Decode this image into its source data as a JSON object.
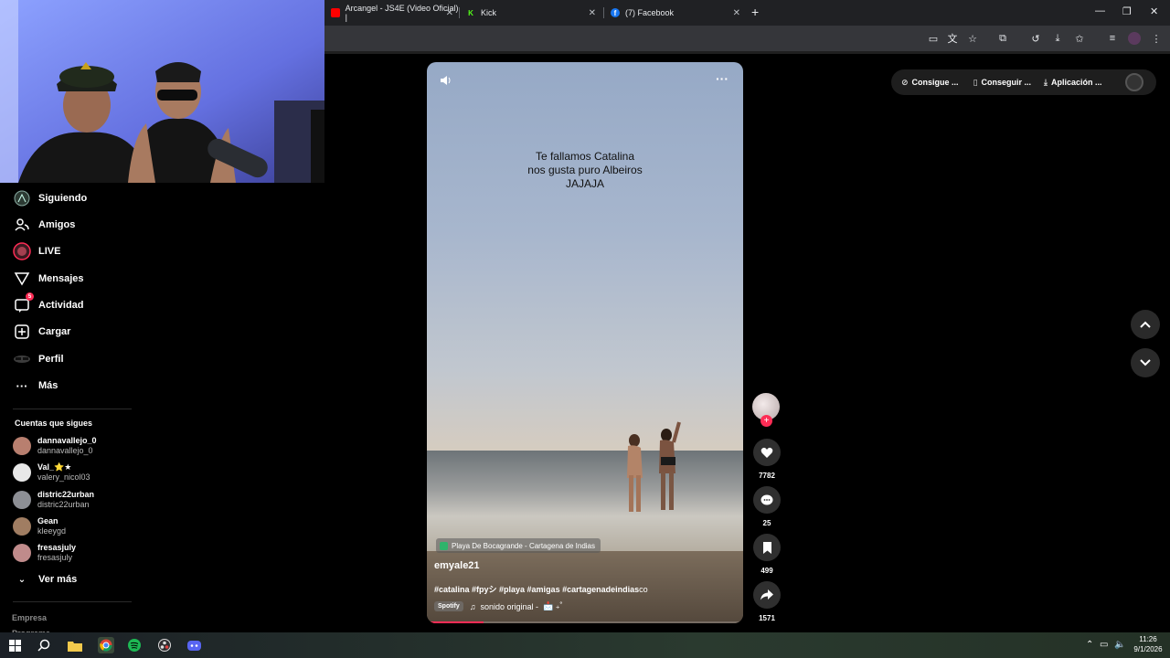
{
  "browser": {
    "tabs": [
      {
        "label": "Arcangel - JS4E (Video Oficial) |"
      },
      {
        "label": "Kick"
      },
      {
        "label": "(7) Facebook"
      }
    ],
    "new_tab": "+",
    "window_controls": {
      "minimize": "—",
      "maximize": "❐",
      "close": "✕"
    }
  },
  "sidebar": {
    "items": [
      {
        "label": "Siguiendo",
        "icon": "following-icon"
      },
      {
        "label": "Amigos",
        "icon": "friends-icon"
      },
      {
        "label": "LIVE",
        "icon": "live-icon"
      },
      {
        "label": "Mensajes",
        "icon": "messages-icon"
      },
      {
        "label": "Actividad",
        "icon": "activity-icon",
        "badge": "5"
      },
      {
        "label": "Cargar",
        "icon": "upload-icon"
      },
      {
        "label": "Perfil",
        "icon": "profile-icon"
      },
      {
        "label": "Más",
        "icon": "more-icon"
      }
    ],
    "following_title": "Cuentas que sigues",
    "accounts": [
      {
        "name": "dannavallejo_0",
        "user": "dannavallejo_0",
        "color": "#b87f6f"
      },
      {
        "name": "Val_⭐★",
        "user": "valery_nicol03",
        "color": "#e8e8e8"
      },
      {
        "name": "distric22urban",
        "user": "distric22urban",
        "color": "#8d8f95"
      },
      {
        "name": "Gean",
        "user": "kleeygd",
        "color": "#a07d62"
      },
      {
        "name": "fresasjuly",
        "user": "fresasjuly",
        "color": "#c08b8b"
      }
    ],
    "see_more": "Ver más",
    "footer": [
      "Empresa",
      "Programa"
    ]
  },
  "video": {
    "overlay_text": [
      "Te fallamos Catalina",
      "nos gusta puro Albeiros",
      "JAJAJA"
    ],
    "location": "Playa De Bocagrande - Cartagena de Indias",
    "author": "emyale21",
    "tags": "#catalina #fpyシ #playa #amigas #cartagenadeindias",
    "tags_tail": "co",
    "spotify": "Spotify",
    "sound": "sonido original -",
    "progress": 0.18
  },
  "actions": {
    "likes": "7782",
    "comments": "25",
    "saves": "499",
    "shares": "1571"
  },
  "topbar": {
    "get_coins": "Consigue ...",
    "get_app": "Conseguir ...",
    "desktop_app": "Aplicación ..."
  },
  "taskbar": {
    "time": "11:26",
    "date": "9/1/2026"
  },
  "colors": {
    "accent": "#fe2c55",
    "background": "#000000",
    "chrome": "#202124"
  }
}
